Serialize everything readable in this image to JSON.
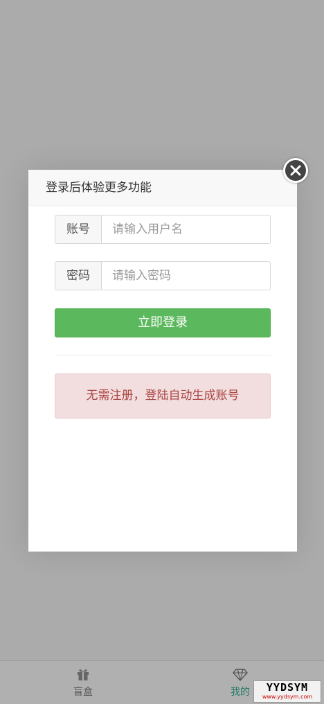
{
  "modal": {
    "title": "登录后体验更多功能",
    "username": {
      "label": "账号",
      "placeholder": "请输入用户名",
      "value": ""
    },
    "password": {
      "label": "密码",
      "placeholder": "请输入密码",
      "value": ""
    },
    "login_button": "立即登录",
    "notice": "无需注册，登陆自动生成账号",
    "close_icon": "close-icon"
  },
  "tabbar": {
    "items": [
      {
        "label": "盲盒",
        "icon": "gift-icon",
        "active": false
      },
      {
        "label": "我的",
        "icon": "diamond-icon",
        "active": true
      }
    ]
  },
  "watermark": {
    "main": "YYDSYM",
    "sub": "www.yydsym.com"
  },
  "colors": {
    "overlay": "#ababab",
    "success": "#5cb85c",
    "alert_bg": "#f2dede",
    "alert_text": "#a94442",
    "active_tab": "#1f7a63"
  }
}
